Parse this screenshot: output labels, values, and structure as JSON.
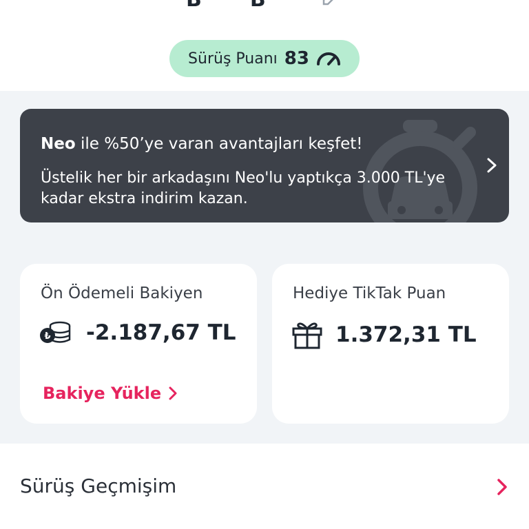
{
  "header": {
    "name_glyphs": [
      "B",
      "B"
    ],
    "edit_icon": "pencil-edit-icon"
  },
  "driving_score": {
    "label": "Sürüş Puanı",
    "value": "83",
    "icon": "speedometer-gauge-icon",
    "background": "#b7ecd1"
  },
  "promo_banner": {
    "brand": "Neo",
    "headline_rest": " ile %50’ye varan avantajları keşfet!",
    "body": "Üstelik her bir arkadaşını Neo'lu yaptıkça 3.000 TL'ye kadar ekstra indirim kazan.",
    "watermark_icon": "stopwatch-car-icon",
    "chevron_icon": "chevron-right-icon",
    "background": "#3d4149"
  },
  "prepaid_card": {
    "title": "Ön Ödemeli Bakiyen",
    "amount": "-2.187,67 TL",
    "icon": "coins-stack-icon",
    "action_label": "Bakiye Yükle",
    "action_color": "#e6245e"
  },
  "gift_card": {
    "title": "Hediye TikTak Puan",
    "amount": "1.372,31 TL",
    "icon": "gift-box-icon"
  },
  "history": {
    "label": "Sürüş Geçmişim",
    "chevron_icon": "chevron-right-icon",
    "accent": "#e6245e"
  }
}
